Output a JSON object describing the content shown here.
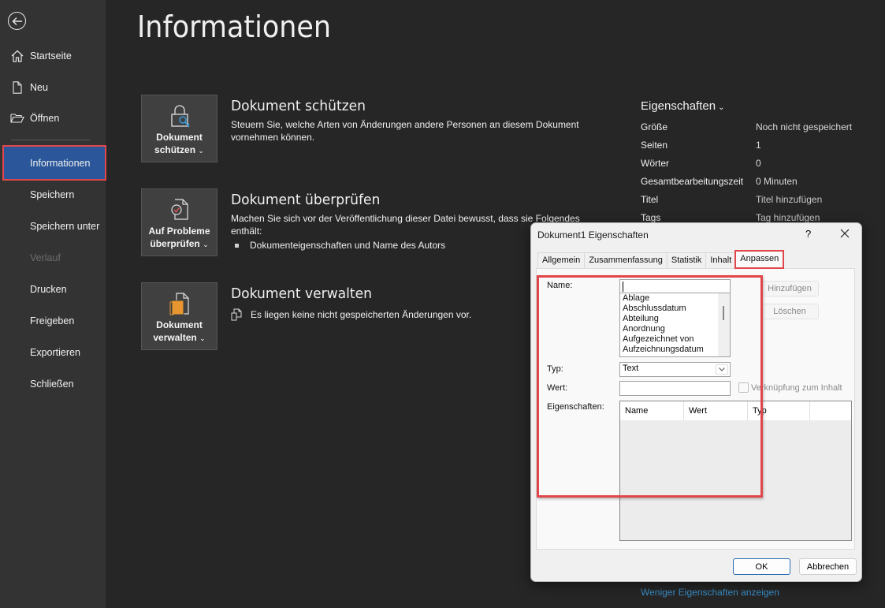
{
  "sidebar": {
    "back_icon": "back-arrow-icon",
    "items": [
      {
        "label": "Startseite",
        "icon": "home-icon",
        "state": "normal"
      },
      {
        "label": "Neu",
        "icon": "new-document-icon",
        "state": "normal"
      },
      {
        "label": "Öffnen",
        "icon": "folder-open-icon",
        "state": "normal"
      },
      {
        "label": "Informationen",
        "state": "active"
      },
      {
        "label": "Speichern",
        "state": "normal"
      },
      {
        "label": "Speichern unter",
        "state": "normal"
      },
      {
        "label": "Verlauf",
        "state": "disabled"
      },
      {
        "label": "Drucken",
        "state": "normal"
      },
      {
        "label": "Freigeben",
        "state": "normal"
      },
      {
        "label": "Exportieren",
        "state": "normal"
      },
      {
        "label": "Schließen",
        "state": "normal"
      }
    ]
  },
  "main": {
    "title": "Informationen",
    "sections": [
      {
        "tile_line1": "Dokument",
        "tile_line2": "schützen",
        "icon": "lock-key-icon",
        "heading": "Dokument schützen",
        "description": "Steuern Sie, welche Arten von Änderungen andere Personen an diesem Dokument vornehmen können."
      },
      {
        "tile_line1": "Auf Probleme",
        "tile_line2": "überprüfen",
        "icon": "document-check-icon",
        "heading": "Dokument überprüfen",
        "description": "Machen Sie sich vor der Veröffentlichung dieser Datei bewusst, dass sie Folgendes enthält:",
        "bullets": [
          "Dokumenteigenschaften und Name des Autors"
        ]
      },
      {
        "tile_line1": "Dokument",
        "tile_line2": "verwalten",
        "icon": "manage-document-icon",
        "heading": "Dokument verwalten",
        "description": "Es liegen keine nicht gespeicherten Änderungen vor."
      }
    ]
  },
  "properties": {
    "title": "Eigenschaften",
    "rows": [
      {
        "key": "Größe",
        "value": "Noch nicht gespeichert"
      },
      {
        "key": "Seiten",
        "value": "1"
      },
      {
        "key": "Wörter",
        "value": "0"
      },
      {
        "key": "Gesamtbearbeitungszeit",
        "value": "0 Minuten"
      },
      {
        "key": "Titel",
        "value": "Titel hinzufügen"
      },
      {
        "key": "Tags",
        "value": "Tag hinzufügen"
      }
    ],
    "less_link": "Weniger Eigenschaften anzeigen"
  },
  "dialog": {
    "title": "Dokument1 Eigenschaften",
    "help": "?",
    "tabs": [
      "Allgemein",
      "Zusammenfassung",
      "Statistik",
      "Inhalt",
      "Anpassen"
    ],
    "active_tab": "Anpassen",
    "name_label": "Name:",
    "name_value": "",
    "name_options": [
      "Ablage",
      "Abschlussdatum",
      "Abteilung",
      "Anordnung",
      "Aufgezeichnet von",
      "Aufzeichnungsdatum"
    ],
    "typ_label": "Typ:",
    "typ_value": "Text",
    "wert_label": "Wert:",
    "wert_value": "",
    "link_checkbox_label": "Verknüpfung zum Inhalt",
    "link_checked": false,
    "add_button": "Hinzufügen",
    "delete_button": "Löschen",
    "props_label": "Eigenschaften:",
    "table_columns": [
      "Name",
      "Wert",
      "Typ",
      ""
    ],
    "table_rows": [],
    "ok_button": "OK",
    "cancel_button": "Abbrechen"
  },
  "colors": {
    "accent_active": "#2b579a",
    "highlight_annotation": "#e0464a",
    "link": "#3a8fc9"
  }
}
